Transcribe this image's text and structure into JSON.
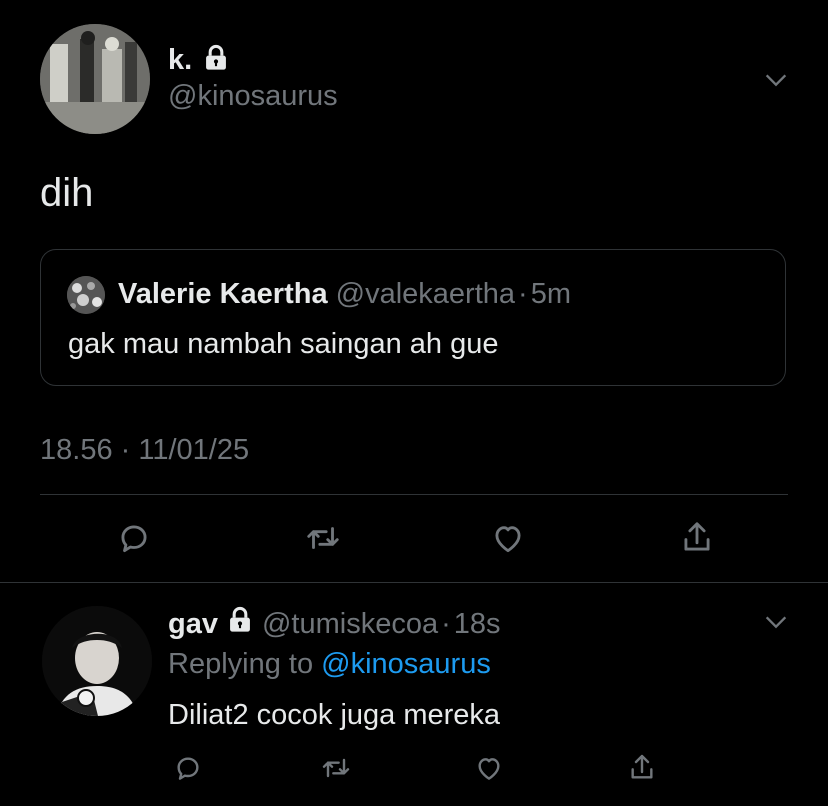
{
  "main_tweet": {
    "display_name": "k.",
    "handle": "@kinosaurus",
    "text": "dih",
    "timestamp": "18.56 · 11/01/25",
    "protected": true
  },
  "quoted_tweet": {
    "display_name": "Valerie Kaertha",
    "handle": "@valekaertha",
    "separator": "·",
    "time": "5m",
    "text": "gak mau nambah saingan ah gue"
  },
  "reply_tweet": {
    "display_name": "gav",
    "handle": "@tumiskecoa",
    "separator": "·",
    "time": "18s",
    "replying_prefix": "Replying to",
    "replying_handle": "@kinosaurus",
    "text": "Diliat2 cocok juga mereka",
    "protected": true
  },
  "actions": [
    "reply-icon",
    "retweet-icon",
    "like-icon",
    "share-icon"
  ],
  "colors": {
    "background": "#000000",
    "text": "#e7e9ea",
    "muted": "#71767b",
    "link": "#1d9bf0",
    "border": "#2f3336"
  }
}
